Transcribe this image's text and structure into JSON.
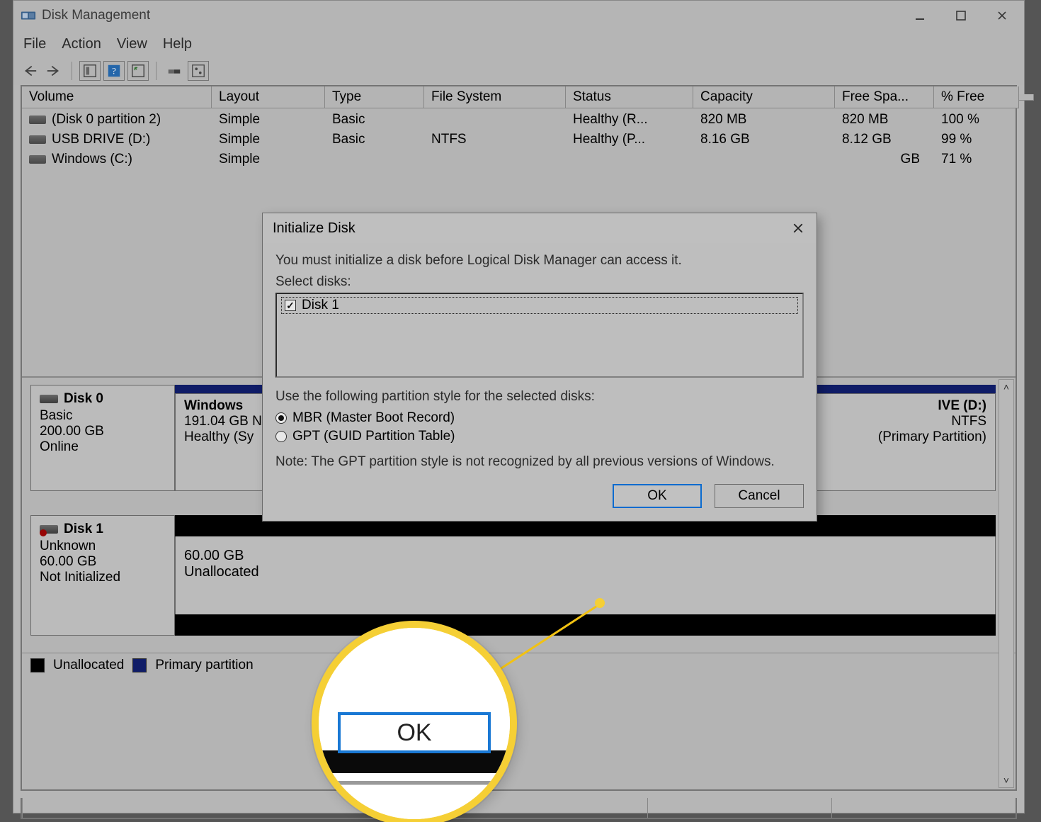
{
  "window": {
    "title": "Disk Management",
    "menus": [
      "File",
      "Action",
      "View",
      "Help"
    ]
  },
  "table": {
    "columns": [
      "Volume",
      "Layout",
      "Type",
      "File System",
      "Status",
      "Capacity",
      "Free Spa...",
      "% Free"
    ],
    "rows": [
      {
        "volume": "(Disk 0 partition 2)",
        "layout": "Simple",
        "type": "Basic",
        "fs": "",
        "status": "Healthy (R...",
        "capacity": "820 MB",
        "free": "820 MB",
        "pct": "100 %"
      },
      {
        "volume": "USB DRIVE (D:)",
        "layout": "Simple",
        "type": "Basic",
        "fs": "NTFS",
        "status": "Healthy (P...",
        "capacity": "8.16 GB",
        "free": "8.12 GB",
        "pct": "99 %"
      },
      {
        "volume": "Windows (C:)",
        "layout": "Simple",
        "type": "",
        "fs": "",
        "status": "",
        "capacity": "",
        "free": "GB",
        "pct": "71 %"
      }
    ]
  },
  "disks": {
    "d0": {
      "name": "Disk 0",
      "type": "Basic",
      "size": "200.00 GB",
      "state": "Online",
      "parts": [
        {
          "title": "Windows",
          "line2": "191.04 GB N",
          "line3": "Healthy (Sy"
        },
        {
          "title": "IVE (D:)",
          "line2": "NTFS",
          "line3": "(Primary Partition)"
        }
      ]
    },
    "d1": {
      "name": "Disk 1",
      "type": "Unknown",
      "size": "60.00 GB",
      "state": "Not Initialized",
      "unalloc": {
        "size": "60.00 GB",
        "label": "Unallocated"
      }
    }
  },
  "legend": {
    "unallocated": "Unallocated",
    "primary": "Primary partition"
  },
  "dialog": {
    "title": "Initialize Disk",
    "lead": "You must initialize a disk before Logical Disk Manager can access it.",
    "select_label": "Select disks:",
    "disk_item": "Disk 1",
    "style_label": "Use the following partition style for the selected disks:",
    "opt_mbr": "MBR (Master Boot Record)",
    "opt_gpt": "GPT (GUID Partition Table)",
    "note": "Note: The GPT partition style is not recognized by all previous versions of Windows.",
    "ok": "OK",
    "cancel": "Cancel"
  },
  "magnifier": {
    "ok": "OK"
  }
}
